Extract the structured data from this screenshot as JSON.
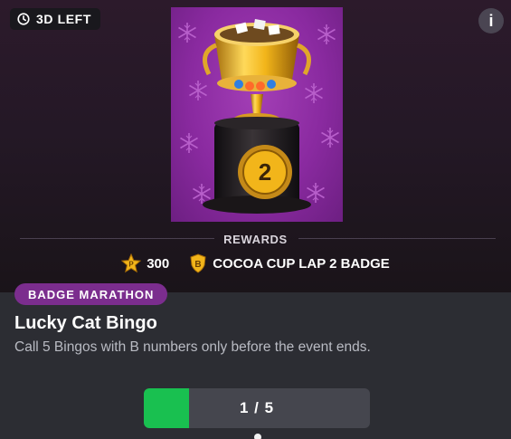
{
  "timer": {
    "label": "3D LEFT",
    "icon": "clock-icon"
  },
  "info_icon": {
    "glyph": "i",
    "icon": "info-icon"
  },
  "art": {
    "badge_number": "2",
    "icon": "cocoa-cup-trophy"
  },
  "rewards": {
    "title": "REWARDS",
    "points_value": "300",
    "points_icon_letter": "P",
    "badge_icon_letter": "B",
    "badge_name": "COCOA CUP LAP 2 BADGE"
  },
  "tag": {
    "label": "BADGE MARATHON"
  },
  "challenge": {
    "title": "Lucky Cat Bingo",
    "description": "Call 5 Bingos with B numbers only before the event ends."
  },
  "progress": {
    "current": 1,
    "total": 5,
    "label": "1 / 5"
  },
  "colors": {
    "accent_purple": "#7b2d8e",
    "progress_green": "#19c050",
    "panel_dark": "#2c2d33",
    "gold": "#f2b51a"
  }
}
